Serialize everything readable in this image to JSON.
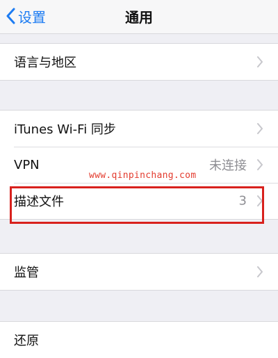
{
  "navbar": {
    "back_label": "设置",
    "title": "通用"
  },
  "rows": {
    "language": {
      "label": "语言与地区"
    },
    "itunes": {
      "label": "iTunes Wi-Fi 同步"
    },
    "vpn": {
      "label": "VPN",
      "value": "未连接"
    },
    "profile": {
      "label": "描述文件",
      "value": "3"
    },
    "supervision": {
      "label": "监管"
    },
    "reset": {
      "label": "还原"
    }
  },
  "watermark": "www.qinpinchang.com",
  "colors": {
    "accent": "#1d7cf2",
    "highlight": "#d8211d",
    "watermark": "#e33b2e",
    "background": "#efeff4"
  }
}
